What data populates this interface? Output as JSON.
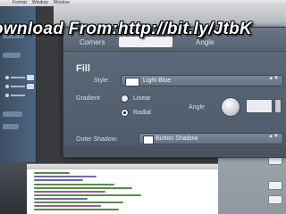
{
  "menubar": {
    "items": [
      "Format",
      "Window",
      "Window"
    ]
  },
  "watermark": {
    "text": "ownload From:http://bit.ly/JtbK"
  },
  "inspector": {
    "corners_label": "Corners",
    "angle_label": "Angle",
    "fill_title": "Fill",
    "style_label": "Style:",
    "style_value": "Light Blue",
    "gradient_label": "Gradient",
    "gradient_options": [
      "Linear",
      "Radial"
    ],
    "gradient_selected": "Radial",
    "gradient_angle_label": "Angle",
    "outer_shadow_label": "Outer Shadow:",
    "outer_shadow_value": "Button Shadow",
    "select_arrows": "▲▼"
  },
  "colors": {
    "hud_background": "#56626f",
    "swatch_fill": "#ffffff",
    "watermark_text": "#ffffff",
    "watermark_outline": "#000000"
  }
}
